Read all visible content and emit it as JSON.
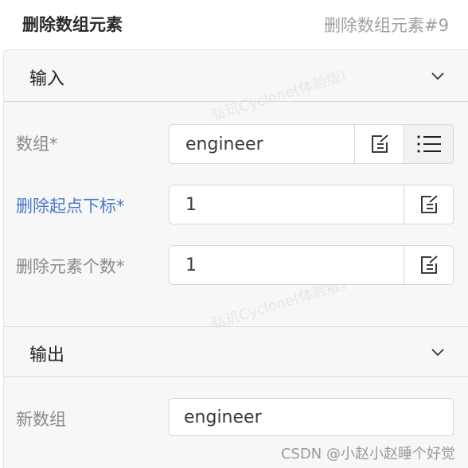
{
  "header": {
    "title": "删除数组元素",
    "id_label": "删除数组元素#9"
  },
  "input_section": {
    "title": "输入",
    "rows": [
      {
        "label": "数组*",
        "value": "engineer"
      },
      {
        "label": "删除起点下标*",
        "value": "1"
      },
      {
        "label": "删除元素个数*",
        "value": "1"
      }
    ]
  },
  "output_section": {
    "title": "输出",
    "rows": [
      {
        "label": "新数组",
        "value": "engineer"
      }
    ]
  },
  "watermark": "弘玑Cyclone(体验版)",
  "footer_credit": "CSDN @小赵小赵睡个好觉",
  "colors": {
    "required_highlight": "#4a78c8",
    "panel_bg": "#f7f7f7"
  }
}
